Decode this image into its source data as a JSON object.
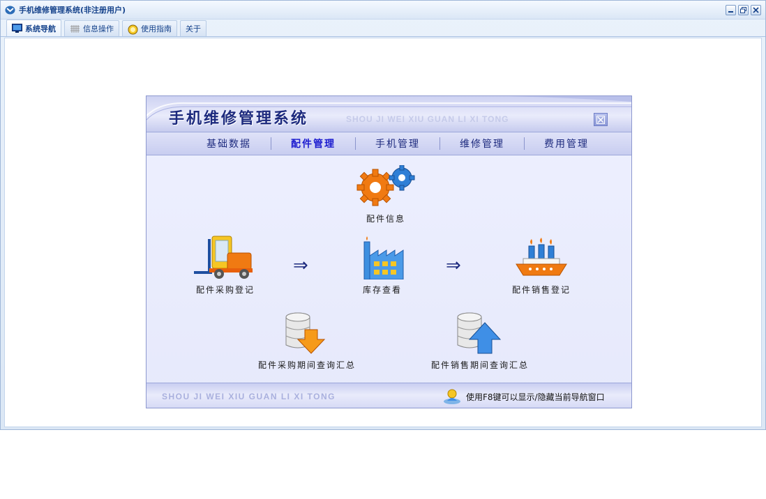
{
  "window": {
    "title": "手机维修管理系统(非注册用户)",
    "controls": [
      "minimize",
      "restore",
      "close"
    ]
  },
  "tabs": [
    {
      "label": "系统导航",
      "icon": "monitor-icon",
      "active": true
    },
    {
      "label": "信息操作",
      "icon": "grid-icon",
      "active": false
    },
    {
      "label": "使用指南",
      "icon": "help-icon",
      "active": false
    },
    {
      "label": "关于",
      "icon": "",
      "active": false
    }
  ],
  "panel": {
    "title": "手机维修管理系统",
    "subtitle": "SHOU JI WEI XIU GUAN LI XI TONG",
    "modules": [
      {
        "label": "基础数据",
        "active": false
      },
      {
        "label": "配件管理",
        "active": true
      },
      {
        "label": "手机管理",
        "active": false
      },
      {
        "label": "维修管理",
        "active": false
      },
      {
        "label": "费用管理",
        "active": false
      }
    ],
    "flow": {
      "parts_info": "配件信息",
      "purchase_register": "配件采购登记",
      "stock_view": "库存查看",
      "sales_register": "配件销售登记",
      "purchase_summary": "配件采购期间查询汇总",
      "sales_summary": "配件销售期间查询汇总",
      "arrow": "⇒"
    },
    "footer_brand": "SHOU JI WEI XIU GUAN LI XI TONG",
    "footer_hint": "使用F8键可以显示/隐藏当前导航窗口"
  },
  "colors": {
    "accent": "#1d2a7e",
    "active_module": "#1b1bcf",
    "window_border": "#9fb7d8",
    "panel_background": "#e6e9fb"
  }
}
